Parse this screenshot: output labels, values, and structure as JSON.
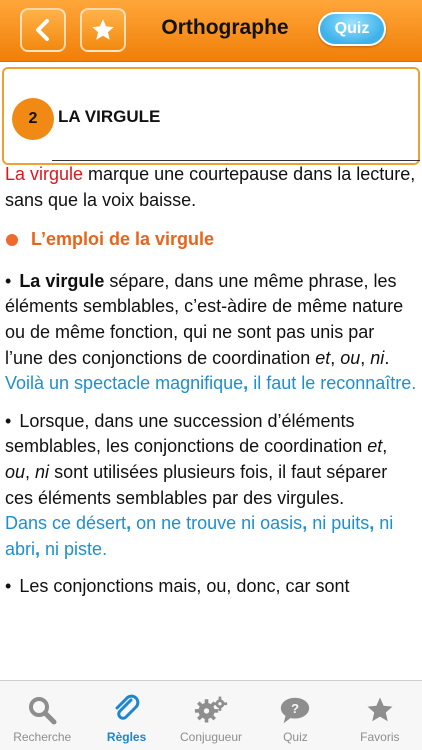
{
  "header": {
    "title": "Orthographe",
    "quiz_label": "Quiz"
  },
  "section": {
    "number": "2",
    "title": "LA VIRGULE"
  },
  "content": {
    "intro_term": "La virgule",
    "intro_rest": " marque une courtepause dans la lecture, sans que la voix baisse.",
    "subheading": "L’emploi de la virgule",
    "rule1": {
      "term": "La virgule",
      "text_a": " sépare, dans une même phrase, les éléments semblables, c’est-àdire de même nature ou de même fonction, qui ne sont pas unis par l’une des conjonctions de coordination ",
      "conj1": "et",
      "sep1": ", ",
      "conj2": "ou",
      "sep2": ", ",
      "conj3": "ni",
      "end": ".",
      "example_a": "Voilà un spectacle magnifique",
      "example_comma": ",",
      "example_b": " il faut le reconnaître."
    },
    "rule2": {
      "text_a": "Lorsque, dans une succession d’éléments semblables, les conjonctions de coordination ",
      "conj1": "et",
      "sep1": ", ",
      "conj2": "ou",
      "sep2": ", ",
      "conj3": "ni",
      "text_b": " sont utilisées plusieurs fois, il faut séparer ces éléments semblables par des virgules.",
      "example_a": "Dans ce désert",
      "c1": ",",
      "example_b": " on ne trouve ni oasis",
      "c2": ",",
      "example_c": " ni puits",
      "c3": ",",
      "example_d": " ni abri",
      "c4": ",",
      "example_e": " ni piste."
    },
    "rule3_partial": "Les conjonctions mais, ou, donc, car sont"
  },
  "tabs": [
    {
      "label": "Recherche",
      "icon": "search-icon",
      "active": false
    },
    {
      "label": "Règles",
      "icon": "paperclip-icon",
      "active": true
    },
    {
      "label": "Conjugueur",
      "icon": "gears-icon",
      "active": false
    },
    {
      "label": "Quiz",
      "icon": "quiz-bubble-icon",
      "active": false
    },
    {
      "label": "Favoris",
      "icon": "star-icon",
      "active": false
    }
  ],
  "colors": {
    "header_orange": "#f07f08",
    "accent_red": "#e0161b",
    "example_blue": "#1e8fd0",
    "subheading_orange": "#e8641a",
    "active_tab_blue": "#1b87d0"
  }
}
